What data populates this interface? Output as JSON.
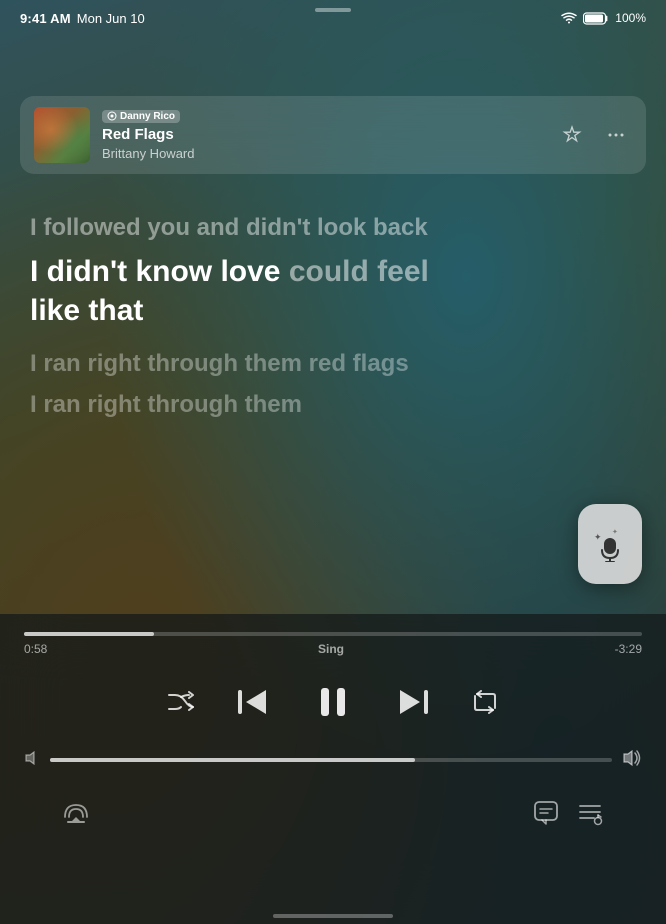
{
  "status_bar": {
    "time": "9:41 AM",
    "date": "Mon Jun 10",
    "wifi_signal": "100%",
    "battery": "100%"
  },
  "now_playing": {
    "dj_label": "Danny Rico",
    "track_title": "Red Flags",
    "track_artist": "Brittany Howard",
    "star_label": "★",
    "more_label": "···"
  },
  "lyrics": {
    "past_line1": "I followed you and didn't look back",
    "active_line1_highlight": "I didn't know love ",
    "active_line1_dim": "could feel",
    "active_line2": "like that",
    "future_line1": "I ran right through them red flags",
    "future_line2": "I ran right through them"
  },
  "progress": {
    "elapsed": "0:58",
    "mode": "Sing",
    "remaining": "-3:29",
    "fill_percent": 21
  },
  "volume": {
    "fill_percent": 65
  },
  "controls": {
    "shuffle": "⇄",
    "prev": "⏮",
    "pause": "⏸",
    "next": "⏭",
    "repeat": "↻"
  },
  "toolbar": {
    "airplay_label": "AirPlay",
    "lyrics_label": "Lyrics",
    "queue_label": "Queue"
  },
  "top_menu": "• • •",
  "mic_icon": "✨🎤"
}
